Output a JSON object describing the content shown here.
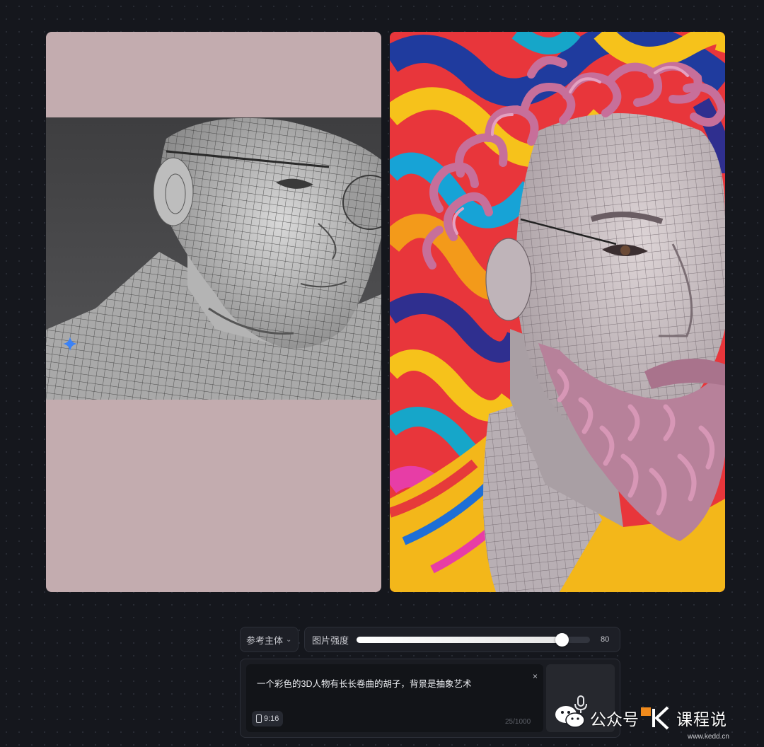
{
  "icons": {
    "sparkle": "sparkle-icon",
    "chevron": "chevron-down-icon",
    "phone": "phone-icon",
    "microphone": "microphone-icon",
    "close": "close-icon",
    "wechat": "wechat-icon"
  },
  "colors": {
    "background": "#15171d",
    "left_panel": "#c3acaf",
    "accent_blue": "#3b82f6",
    "watermark_orange": "#f08a1c"
  },
  "controls": {
    "subject_label": "参考主体",
    "chevron": "⌄",
    "strength_label": "图片强度",
    "strength_value": "80",
    "strength_fraction": 0.88
  },
  "prompt": {
    "text": "一个彩色的3D人物有长长卷曲的胡子，背景是抽象艺术",
    "clear": "×",
    "ratio": "9:16",
    "char_count": "25/1000"
  },
  "watermark": {
    "text_left": "公众号",
    "text_right": "课程说",
    "site": "www.kedd.cn"
  }
}
